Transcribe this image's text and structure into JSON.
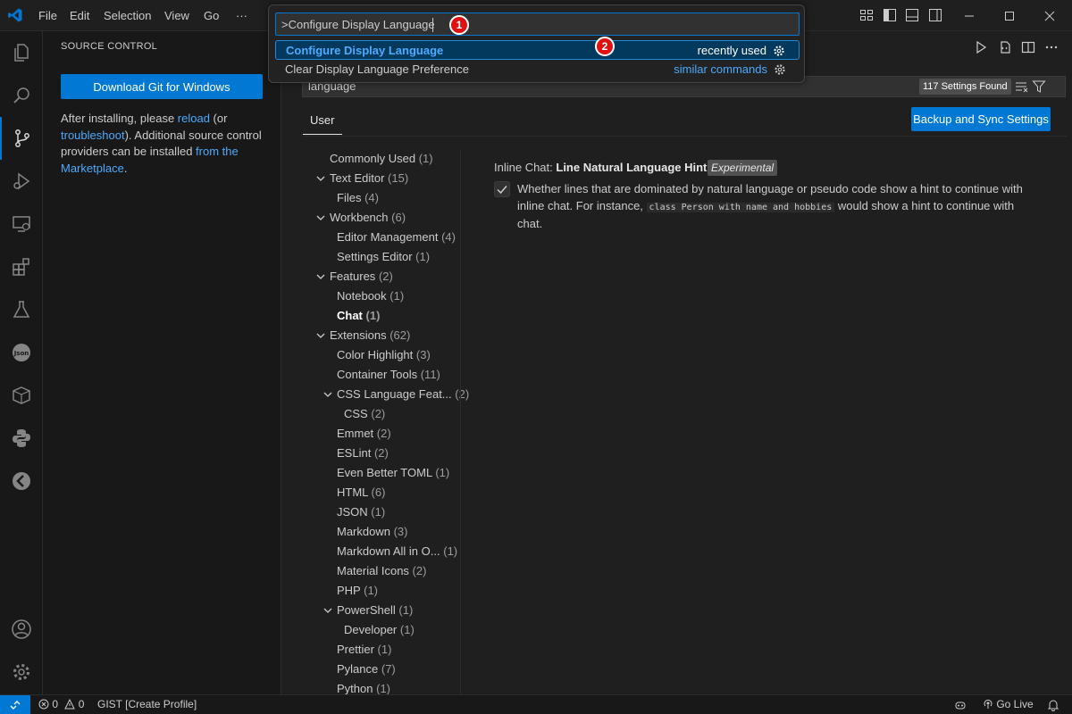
{
  "menu": {
    "file": "File",
    "edit": "Edit",
    "selection": "Selection",
    "view": "View",
    "go": "Go",
    "more": "···"
  },
  "palette": {
    "input_value": ">Configure Display Language",
    "items": [
      {
        "label": "Configure Display Language",
        "right": "recently used"
      },
      {
        "label": "Clear Display Language Preference",
        "right": "similar commands"
      }
    ],
    "markers": [
      "1",
      "2"
    ]
  },
  "sidebar": {
    "title": "SOURCE CONTROL",
    "download_button": "Download Git for Windows",
    "text_1": "After installing, please ",
    "link_reload": "reload",
    "text_2": " (or ",
    "link_troubleshoot": "troubleshoot",
    "text_3": "). Additional source control providers can be installed ",
    "link_marketplace": "from the Marketplace",
    "text_4": "."
  },
  "settings": {
    "search_value": "language",
    "found_badge": "117 Settings Found",
    "tab_user": "User",
    "sync_button": "Backup and Sync Settings",
    "toc": [
      {
        "label": "Commonly Used",
        "count": "(1)",
        "indent": 0,
        "chevron": false
      },
      {
        "label": "Text Editor",
        "count": "(15)",
        "indent": 0,
        "chevron": true
      },
      {
        "label": "Files",
        "count": "(4)",
        "indent": 1,
        "chevron": false
      },
      {
        "label": "Workbench",
        "count": "(6)",
        "indent": 0,
        "chevron": true
      },
      {
        "label": "Editor Management",
        "count": "(4)",
        "indent": 1,
        "chevron": false
      },
      {
        "label": "Settings Editor",
        "count": "(1)",
        "indent": 1,
        "chevron": false
      },
      {
        "label": "Features",
        "count": "(2)",
        "indent": 0,
        "chevron": true
      },
      {
        "label": "Notebook",
        "count": "(1)",
        "indent": 1,
        "chevron": false
      },
      {
        "label": "Chat",
        "count": "(1)",
        "indent": 1,
        "chevron": false,
        "bold": true
      },
      {
        "label": "Extensions",
        "count": "(62)",
        "indent": 0,
        "chevron": true
      },
      {
        "label": "Color Highlight",
        "count": "(3)",
        "indent": 1,
        "chevron": false
      },
      {
        "label": "Container Tools",
        "count": "(11)",
        "indent": 1,
        "chevron": false
      },
      {
        "label": "CSS Language Feat...",
        "count": "(2)",
        "indent": 1,
        "chevron": true
      },
      {
        "label": "CSS",
        "count": "(2)",
        "indent": 2,
        "chevron": false
      },
      {
        "label": "Emmet",
        "count": "(2)",
        "indent": 1,
        "chevron": false
      },
      {
        "label": "ESLint",
        "count": "(2)",
        "indent": 1,
        "chevron": false
      },
      {
        "label": "Even Better TOML",
        "count": "(1)",
        "indent": 1,
        "chevron": false
      },
      {
        "label": "HTML",
        "count": "(6)",
        "indent": 1,
        "chevron": false
      },
      {
        "label": "JSON",
        "count": "(1)",
        "indent": 1,
        "chevron": false
      },
      {
        "label": "Markdown",
        "count": "(3)",
        "indent": 1,
        "chevron": false
      },
      {
        "label": "Markdown All in O...",
        "count": "(1)",
        "indent": 1,
        "chevron": false
      },
      {
        "label": "Material Icons",
        "count": "(2)",
        "indent": 1,
        "chevron": false
      },
      {
        "label": "PHP",
        "count": "(1)",
        "indent": 1,
        "chevron": false
      },
      {
        "label": "PowerShell",
        "count": "(1)",
        "indent": 1,
        "chevron": true
      },
      {
        "label": "Developer",
        "count": "(1)",
        "indent": 2,
        "chevron": false
      },
      {
        "label": "Prettier",
        "count": "(1)",
        "indent": 1,
        "chevron": false
      },
      {
        "label": "Pylance",
        "count": "(7)",
        "indent": 1,
        "chevron": false
      },
      {
        "label": "Python",
        "count": "(1)",
        "indent": 1,
        "chevron": false
      }
    ],
    "setting": {
      "category": "Inline Chat: ",
      "name": "Line Natural Language Hint",
      "tag": "Experimental",
      "desc_1": "Whether lines that are dominated by natural language or pseudo code show a hint to continue with inline chat. For instance, ",
      "code": "class Person with name and hobbies",
      "desc_2": " would show a hint to continue with chat.",
      "checked": true
    }
  },
  "status": {
    "errors": "0",
    "warnings": "0",
    "profile": "GIST [Create Profile]",
    "go_live": "Go Live"
  },
  "colors": {
    "accent": "#0078d4",
    "link": "#4daafc",
    "marker": "#e01111"
  }
}
